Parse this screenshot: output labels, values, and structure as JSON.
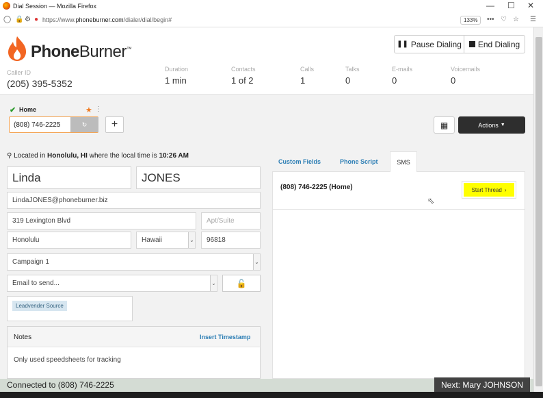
{
  "browser": {
    "window_title": "Dial Session — Mozilla Firefox",
    "url_prefix": "https://www.",
    "url_domain": "phoneburner.com",
    "url_path": "/dialer/dial/begin#",
    "zoom": "133%",
    "more_icon": "•••"
  },
  "logo": {
    "part1": "Phone",
    "part2": "Burner",
    "tm": "™",
    "brand_color": "#f26522"
  },
  "header": {
    "caller_id_label": "Caller ID",
    "caller_id": "(205) 395-5352",
    "stats": [
      {
        "label": "Duration",
        "value": "1 min"
      },
      {
        "label": "Contacts",
        "value": "1 of 2"
      },
      {
        "label": "Calls",
        "value": "1"
      },
      {
        "label": "Talks",
        "value": "0"
      },
      {
        "label": "E-mails",
        "value": "0"
      },
      {
        "label": "Voicemails",
        "value": "0"
      }
    ],
    "pause_label": "Pause Dialing",
    "end_label": "End Dialing"
  },
  "phone": {
    "type_label": "Home",
    "number": "(808) 746-2225",
    "add_label": "+",
    "actions_label": "Actions"
  },
  "location": {
    "prefix": "Located in ",
    "place": "Honolulu, HI",
    "middle": " where the local time is ",
    "time": "10:26 AM"
  },
  "contact": {
    "first_name": "Linda",
    "last_name": "JONES",
    "email": "LindaJONES@phoneburner.biz",
    "address": "319 Lexington Blvd",
    "apt_placeholder": "Apt/Suite",
    "city": "Honolulu",
    "state": "Hawaii",
    "zip": "96818",
    "campaign": "Campaign 1",
    "email_select": "Email to send...",
    "tag": "Leadvender Source"
  },
  "notes": {
    "title": "Notes",
    "insert_label": "Insert Timestamp",
    "text": "Only used speedsheets for tracking"
  },
  "tabs": [
    {
      "label": "Custom Fields"
    },
    {
      "label": "Phone Script"
    },
    {
      "label": "SMS"
    }
  ],
  "sms": {
    "number_line": "(808) 746-2225 (Home)",
    "start_label": "Start Thread",
    "start_color": "#ffff00"
  },
  "footer": {
    "connected": "Connected to (808) 746-2225",
    "next": "Next: Mary JOHNSON"
  }
}
